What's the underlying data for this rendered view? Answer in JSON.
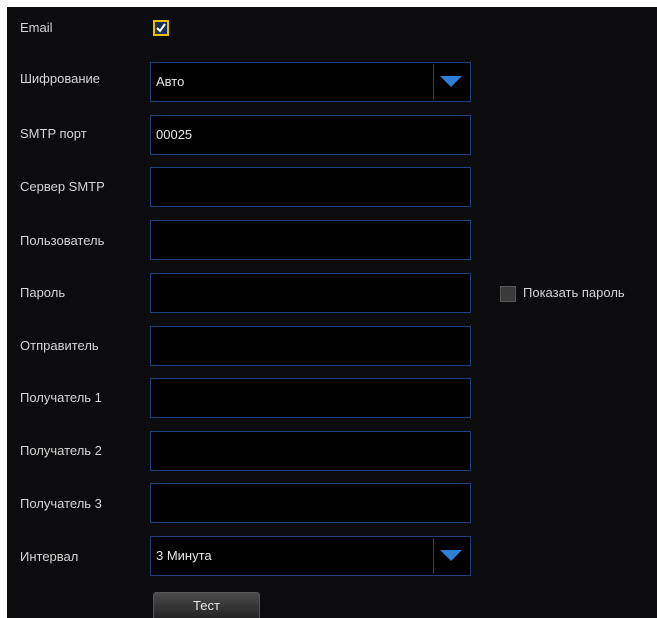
{
  "email": {
    "label": "Email",
    "checked": true
  },
  "encryption": {
    "label": "Шифрование",
    "value": "Авто",
    "arrow_icon": "chevron-down-icon"
  },
  "smtp_port": {
    "label": "SMTP порт",
    "value": "00025"
  },
  "smtp_server": {
    "label": "Сервер SMTP",
    "value": ""
  },
  "user": {
    "label": "Пользователь",
    "value": ""
  },
  "password": {
    "label": "Пароль",
    "value": "",
    "show_label": "Показать пароль",
    "show_checked": false
  },
  "sender": {
    "label": "Отправитель",
    "value": ""
  },
  "recipient1": {
    "label": "Получатель 1",
    "value": ""
  },
  "recipient2": {
    "label": "Получатель 2",
    "value": ""
  },
  "recipient3": {
    "label": "Получатель 3",
    "value": ""
  },
  "interval": {
    "label": "Интервал",
    "value": "3 Минута",
    "arrow_icon": "chevron-down-icon"
  },
  "test_button": {
    "label": "Тест"
  },
  "colors": {
    "background": "#0c0c0e",
    "field_border": "#1e3f7a",
    "arrow": "#2f7fd6",
    "checkbox_border": "#e3c400",
    "text": "#d5d5d5"
  }
}
